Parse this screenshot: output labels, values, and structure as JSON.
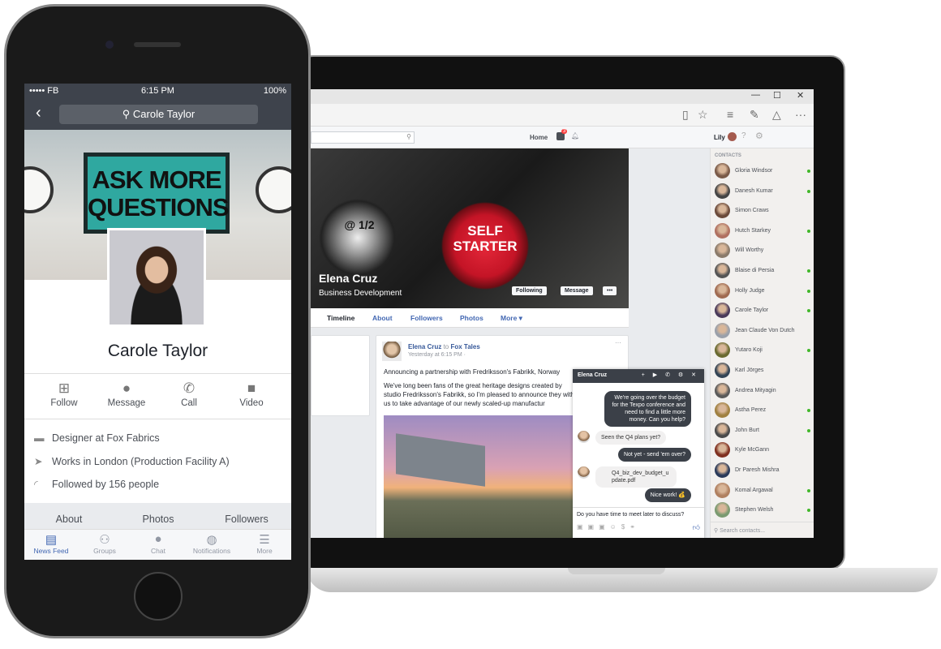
{
  "phone": {
    "status": {
      "carrier": "••••• FB",
      "time": "6:15 PM",
      "battery": "100%"
    },
    "search_value": "Carole Taylor",
    "poster_text": "ASK MORE QUESTIONS",
    "profile_name": "Carole Taylor",
    "actions": [
      {
        "label": "Follow",
        "icon": "follow-icon"
      },
      {
        "label": "Message",
        "icon": "message-icon"
      },
      {
        "label": "Call",
        "icon": "phone-icon"
      },
      {
        "label": "Video",
        "icon": "video-icon"
      }
    ],
    "info": [
      {
        "icon": "briefcase-icon",
        "text": "Designer at Fox Fabrics"
      },
      {
        "icon": "location-icon",
        "text": "Works in London (Production Facility A)"
      },
      {
        "icon": "rss-icon",
        "text": "Followed by 156 people"
      }
    ],
    "tabs": [
      "About",
      "Photos",
      "Followers"
    ],
    "bottom_tabs": [
      {
        "label": "News Feed",
        "active": true
      },
      {
        "label": "Groups"
      },
      {
        "label": "Chat"
      },
      {
        "label": "Notifications"
      },
      {
        "label": "More"
      }
    ],
    "accent": "#4267b2"
  },
  "laptop": {
    "header": {
      "home": "Home",
      "notif_count": "3",
      "user": "Lily"
    },
    "cover": {
      "name": "Elena Cruz",
      "title": "Business Development",
      "key_left": "@ 1/2",
      "key_right": "SELF STARTER",
      "following": "Following",
      "message": "Message",
      "more": "•••"
    },
    "tabs": [
      "Timeline",
      "About",
      "Followers",
      "Photos",
      "More ▾"
    ],
    "post": {
      "author": "Elena Cruz",
      "to": "to",
      "group": "Fox Tales",
      "time": "Yesterday at 6:15 PM · ",
      "line1": "Announcing a partnership with Fredriksson's Fabrikk, Norway",
      "line2": "We've long been fans of the great heritage designs created by studio Fredriksson's Fabrikk, so I'm pleased to announce they with us to take advantage of our newly scaled-up manufactur"
    },
    "chat": {
      "name": "Elena Cruz",
      "messages": [
        {
          "dir": "out",
          "text": "We're going over the budget for the Texpo conference and need to find a little more money. Can you help?"
        },
        {
          "dir": "in",
          "text": "Seen the Q4 plans yet?"
        },
        {
          "dir": "out",
          "text": "Not yet - send 'em over?"
        },
        {
          "dir": "in",
          "text": "Q4_biz_dev_budget_update.pdf"
        },
        {
          "dir": "out",
          "text": "Nice work! 💰"
        }
      ],
      "input_value": "Do you have time to meet later to discuss?"
    },
    "contacts": {
      "heading": "CONTACTS",
      "search_placeholder": "Search contacts...",
      "items": [
        {
          "name": "Gloria Windsor",
          "online": true
        },
        {
          "name": "Danesh Kumar",
          "online": true
        },
        {
          "name": "Simon Craws",
          "online": false
        },
        {
          "name": "Hutch Starkey",
          "online": true
        },
        {
          "name": "Will Worthy",
          "online": false
        },
        {
          "name": "Blaise di Persia",
          "online": true
        },
        {
          "name": "Holly Judge",
          "online": true
        },
        {
          "name": "Carole Taylor",
          "online": true
        },
        {
          "name": "Jean Claude Von Dutch",
          "online": false
        },
        {
          "name": "Yutaro Koji",
          "online": true
        },
        {
          "name": "Karl Jörges",
          "online": false
        },
        {
          "name": "Andrea Mityagin",
          "online": false
        },
        {
          "name": "Astha Perez",
          "online": true
        },
        {
          "name": "John Burt",
          "online": true
        },
        {
          "name": "Kyle McGann",
          "online": false
        },
        {
          "name": "Dr Paresh Mishra",
          "online": false
        },
        {
          "name": "Komal Argawal",
          "online": true
        },
        {
          "name": "Stephen Welsh",
          "online": true
        }
      ]
    }
  }
}
